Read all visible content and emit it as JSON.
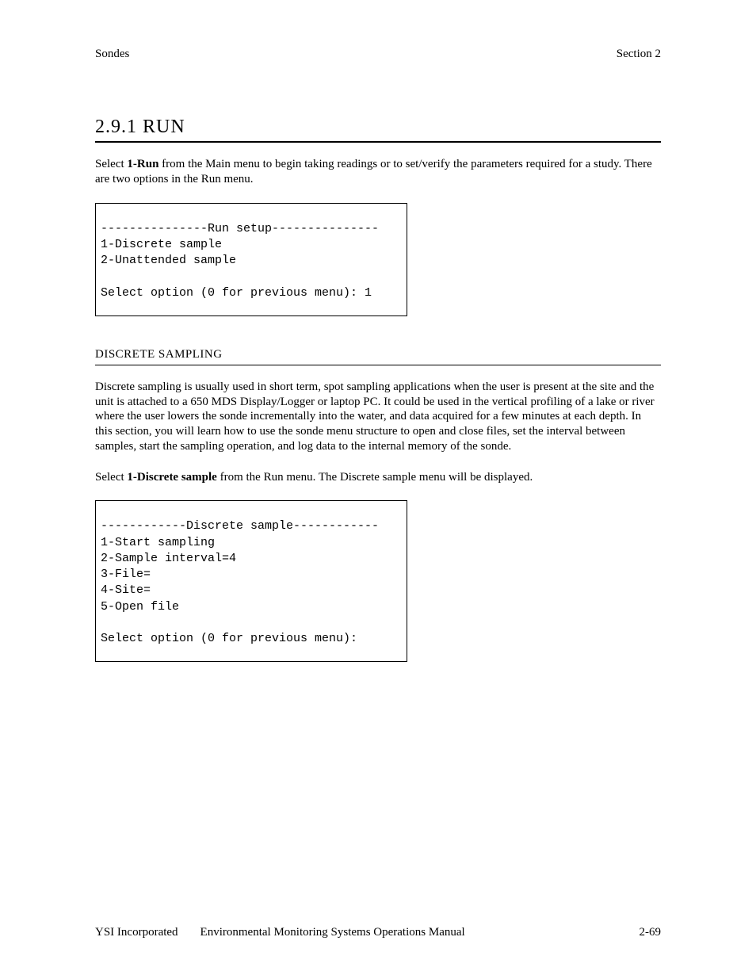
{
  "header": {
    "left": "Sondes",
    "right": "Section 2"
  },
  "heading": "2.9.1  RUN",
  "intro": {
    "pre": "Select ",
    "bold": "1-Run",
    "post": " from the Main menu to begin taking readings or to set/verify the parameters required for a study.  There are two options in the Run menu."
  },
  "terminal1": "---------------Run setup---------------\n1-Discrete sample\n2-Unattended sample\n\nSelect option (0 for previous menu): 1",
  "subheading": "DISCRETE SAMPLING",
  "para2": "Discrete sampling is usually used in short term, spot sampling applications when the user is present at the site and the unit is attached to a 650 MDS Display/Logger or laptop PC.   It could be used in the vertical profiling of a lake or river where the user lowers the sonde incrementally into the water, and data acquired for a few minutes at each depth.   In this section, you will learn how to use the sonde menu structure to open and close files, set the interval between samples, start the sampling operation, and log data to the internal memory of the sonde.",
  "para3": {
    "pre": "Select ",
    "bold": "1-Discrete sample",
    "post": " from the Run menu.  The Discrete sample menu will be displayed."
  },
  "terminal2": "------------Discrete sample------------\n1-Start sampling\n2-Sample interval=4\n3-File=\n4-Site=\n5-Open file\n\nSelect option (0 for previous menu):",
  "footer": {
    "company": "YSI Incorporated",
    "title": "Environmental Monitoring Systems Operations Manual",
    "page": "2-69"
  }
}
